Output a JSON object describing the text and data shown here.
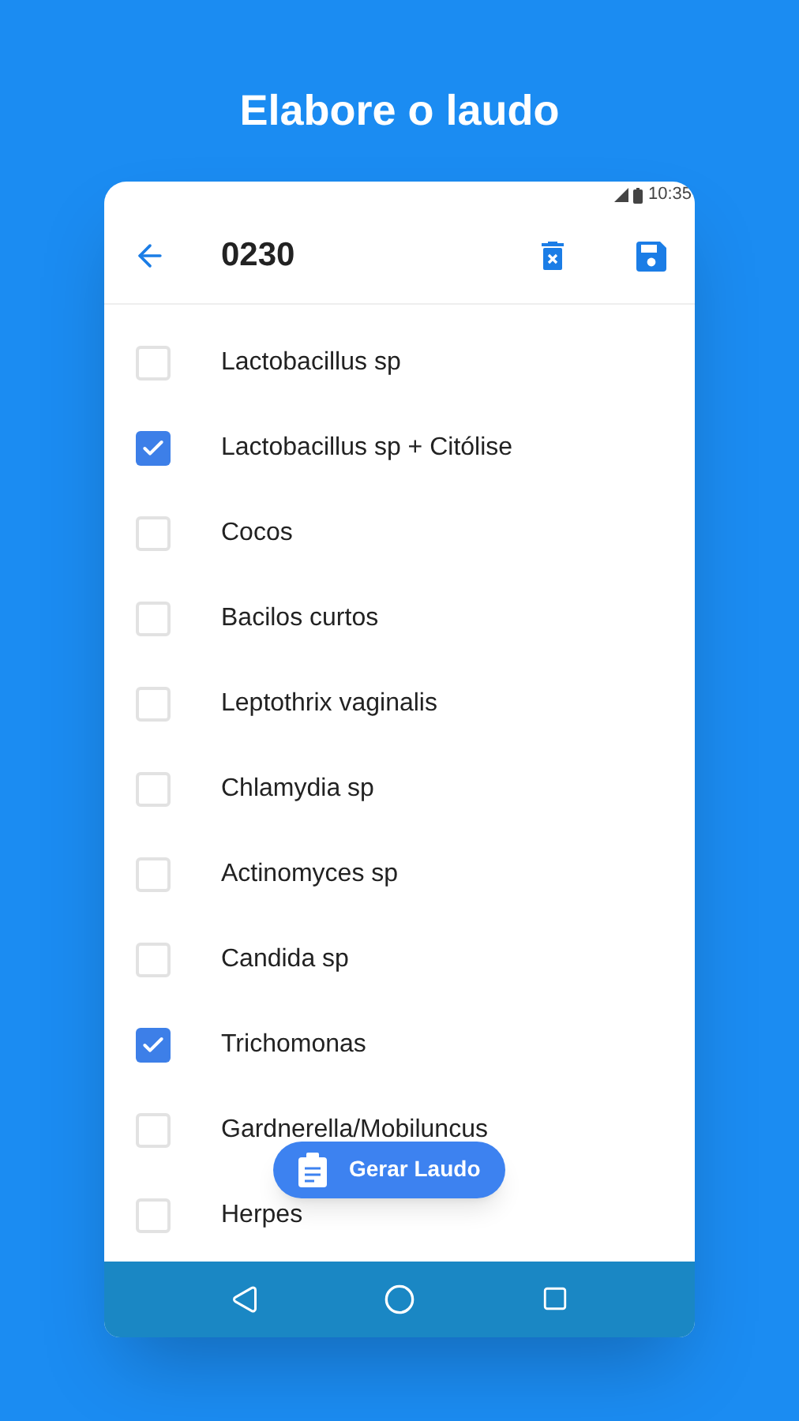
{
  "headline": "Elabore o laudo",
  "status_bar": {
    "time": "10:35"
  },
  "app_bar": {
    "title": "0230"
  },
  "items": [
    {
      "label": "Lactobacillus sp",
      "checked": false
    },
    {
      "label": "Lactobacillus sp + Citólise",
      "checked": true
    },
    {
      "label": "Cocos",
      "checked": false
    },
    {
      "label": "Bacilos curtos",
      "checked": false
    },
    {
      "label": "Leptothrix vaginalis",
      "checked": false
    },
    {
      "label": "Chlamydia sp",
      "checked": false
    },
    {
      "label": "Actinomyces sp",
      "checked": false
    },
    {
      "label": "Candida sp",
      "checked": false
    },
    {
      "label": "Trichomonas",
      "checked": true
    },
    {
      "label": "Gardnerella/Mobiluncus",
      "checked": false
    },
    {
      "label": "Herpes",
      "checked": false
    }
  ],
  "fab": {
    "label": "Gerar Laudo"
  }
}
